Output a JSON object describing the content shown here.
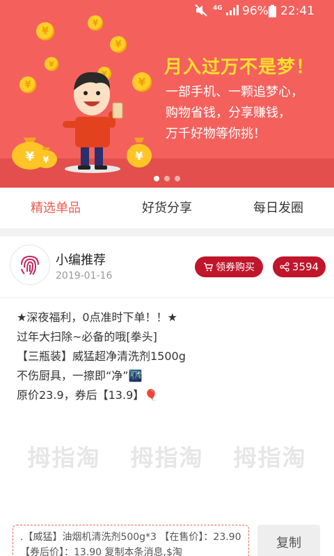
{
  "status_bar": {
    "mute_icon": "mute-icon",
    "network": "4G",
    "battery": "96%",
    "time": "22:41"
  },
  "banner": {
    "title": "月入过万不是梦！",
    "lines": [
      "一部手机、一颗追梦心，",
      "购物省钱，分享赚钱，",
      "万千好物等你挑！"
    ],
    "coin_symbol": "¥",
    "page_indicator": {
      "count": 3,
      "active": 0
    },
    "colors": {
      "background": "#f4615d",
      "title": "#ffe02a",
      "coin": "#ffcc29"
    }
  },
  "tabs": [
    {
      "label": "精选单品",
      "active": true
    },
    {
      "label": "好货分享",
      "active": false
    },
    {
      "label": "每日发圈",
      "active": false
    }
  ],
  "post": {
    "author": "小编推荐",
    "date": "2019-01-16",
    "coupon_button": "领券购买",
    "share_count": "3594",
    "lines": [
      "★深夜福利，0点准时下单！！★",
      "过年大扫除~必备的哦[拳头]",
      "【三瓶装】威猛超净清洗剂1500g",
      "不伤厨具，一擦即“净”🌃",
      "原价23.9，券后【13.9】🎈"
    ],
    "watermark": "拇指淘",
    "copy_text": ".【威猛】油烟机清洗剂500g*3 【在售价】：23.90 【券后价】：13.90 复制本条消息,$淘",
    "copy_button": "复制"
  },
  "colors": {
    "accent": "#f05a4a",
    "button_red": "#c0152b"
  }
}
